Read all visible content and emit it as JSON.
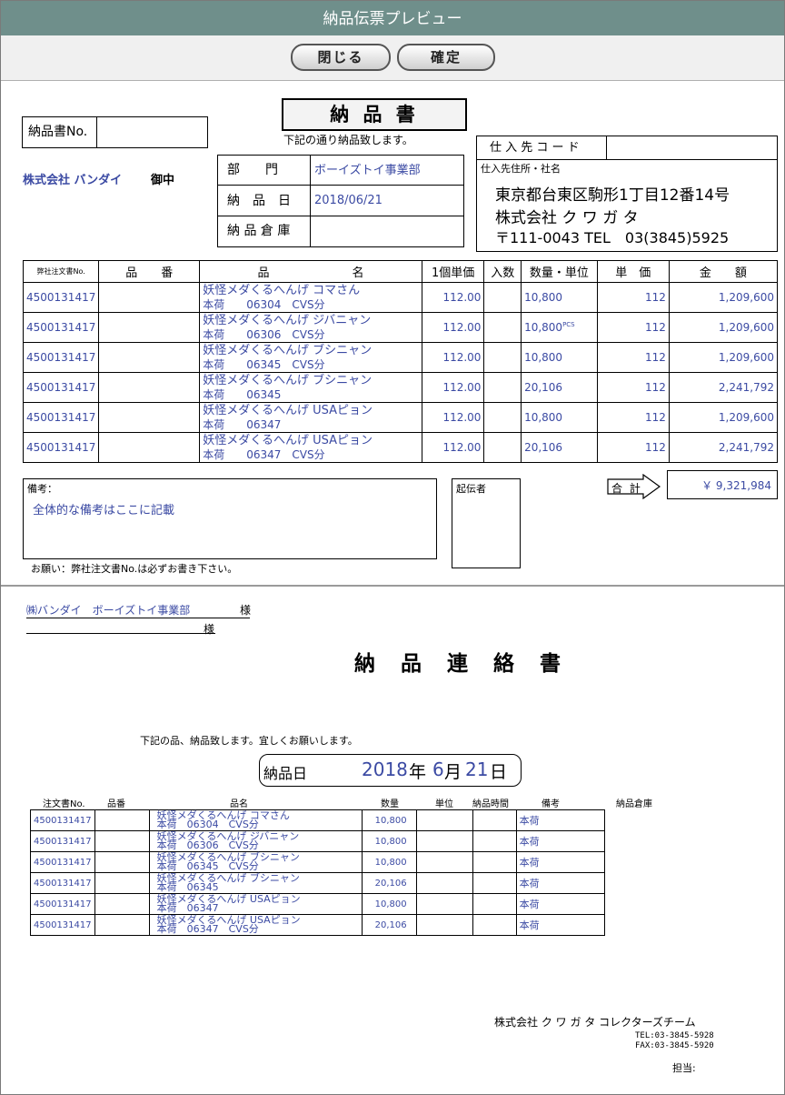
{
  "window": {
    "title": "納品伝票プレビュー"
  },
  "toolbar": {
    "close_label": "閉じる",
    "confirm_label": "確定"
  },
  "slip": {
    "title": "納 品 書",
    "subtitle": "下記の通り納品致します。",
    "slip_no_label": "納品書No.",
    "slip_no_value": "",
    "customer": "株式会社 バンダイ",
    "honorific": "御中",
    "dept_label": "部　　門",
    "dept_value": "ボーイズトイ事業部",
    "date_label": "納　品　日",
    "date_value": "2018/06/21",
    "warehouse_label": "納 品 倉 庫",
    "warehouse_value": "",
    "supplier_code_label": "仕 入 先 コ ー ド",
    "supplier_code_value": "",
    "supplier_addr_label": "仕入先住所・社名",
    "supplier_address": "東京都台東区駒形1丁目12番14号",
    "supplier_name": "株式会社 ク ワ ガ タ",
    "supplier_tel": "〒111-0043 TEL　03(3845)5925",
    "columns": [
      "弊社注文書No.",
      "品　　番",
      "品　　　　　　　名",
      "1個単価",
      "入数",
      "数量・単位",
      "単　価",
      "金　　額"
    ],
    "rows": [
      {
        "order": "4500131417",
        "code": "",
        "name1": "妖怪メダくるへんげ コマさん",
        "name2": "本荷　　06304　CVS分",
        "unit_price": "112.00",
        "qty": "10,800",
        "unit": "",
        "price": "112",
        "amount": "1,209,600"
      },
      {
        "order": "4500131417",
        "code": "",
        "name1": "妖怪メダくるへんげ ジバニャン",
        "name2": "本荷　　06306　CVS分",
        "unit_price": "112.00",
        "qty": "10,800",
        "unit": "PCS",
        "price": "112",
        "amount": "1,209,600"
      },
      {
        "order": "4500131417",
        "code": "",
        "name1": "妖怪メダくるへんげ ブシニャン",
        "name2": "本荷　　06345　CVS分",
        "unit_price": "112.00",
        "qty": "10,800",
        "unit": "",
        "price": "112",
        "amount": "1,209,600"
      },
      {
        "order": "4500131417",
        "code": "",
        "name1": "妖怪メダくるへんげ ブシニャン",
        "name2": "本荷　　06345",
        "unit_price": "112.00",
        "qty": "20,106",
        "unit": "",
        "price": "112",
        "amount": "2,241,792"
      },
      {
        "order": "4500131417",
        "code": "",
        "name1": "妖怪メダくるへんげ USAピョン",
        "name2": "本荷　　06347",
        "unit_price": "112.00",
        "qty": "10,800",
        "unit": "",
        "price": "112",
        "amount": "1,209,600"
      },
      {
        "order": "4500131417",
        "code": "",
        "name1": "妖怪メダくるへんげ USAピョン",
        "name2": "本荷　　06347　CVS分",
        "unit_price": "112.00",
        "qty": "20,106",
        "unit": "",
        "price": "112",
        "amount": "2,241,792"
      }
    ],
    "total_label": "合 計",
    "total_value": "￥ 9,321,984",
    "remarks_label": "備考：",
    "remarks_value": "全体的な備考はここに記載",
    "issuer_label": "起伝者",
    "note": "お願い：弊社注文書No.は必ずお書き下さい。"
  },
  "notice": {
    "to_line": "㈱バンダイ　ボーイズトイ事業部",
    "sama1": "様",
    "sama2": "様",
    "title": "納 品 連 絡 書",
    "message": "下記の品、納品致します。宜しくお願いします。",
    "date_label": "納品日",
    "date_year": "2018",
    "date_nen": "年",
    "date_month": "6",
    "date_tsuki": "月",
    "date_day": "21",
    "date_nichi": "日",
    "columns": [
      "注文書No.",
      "品番",
      "品名",
      "数量",
      "単位",
      "納品時間",
      "備考",
      "納品倉庫"
    ],
    "rows": [
      {
        "order": "4500131417",
        "code": "",
        "name1": "妖怪メダくるへんげ コマさん",
        "name2": "本荷　06304　CVS分",
        "qty": "10,800",
        "unit": "",
        "time": "",
        "note": "本荷"
      },
      {
        "order": "4500131417",
        "code": "",
        "name1": "妖怪メダくるへんげ ジバニャン",
        "name2": "本荷　06306　CVS分",
        "qty": "10,800",
        "unit": "",
        "time": "",
        "note": "本荷"
      },
      {
        "order": "4500131417",
        "code": "",
        "name1": "妖怪メダくるへんげ ブシニャン",
        "name2": "本荷　06345　CVS分",
        "qty": "10,800",
        "unit": "",
        "time": "",
        "note": "本荷"
      },
      {
        "order": "4500131417",
        "code": "",
        "name1": "妖怪メダくるへんげ ブシニャン",
        "name2": "本荷　06345",
        "qty": "20,106",
        "unit": "",
        "time": "",
        "note": "本荷"
      },
      {
        "order": "4500131417",
        "code": "",
        "name1": "妖怪メダくるへんげ USAピョン",
        "name2": "本荷　06347",
        "qty": "10,800",
        "unit": "",
        "time": "",
        "note": "本荷"
      },
      {
        "order": "4500131417",
        "code": "",
        "name1": "妖怪メダくるへんげ USAピョン",
        "name2": "本荷　06347　CVS分",
        "qty": "20,106",
        "unit": "",
        "time": "",
        "note": "本荷"
      }
    ],
    "company": "株式会社 ク ワ ガ タ コレクターズチーム",
    "tel": "TEL:03-3845-5928",
    "fax": "FAX:03-3845-5920",
    "tanto": "担当:"
  }
}
